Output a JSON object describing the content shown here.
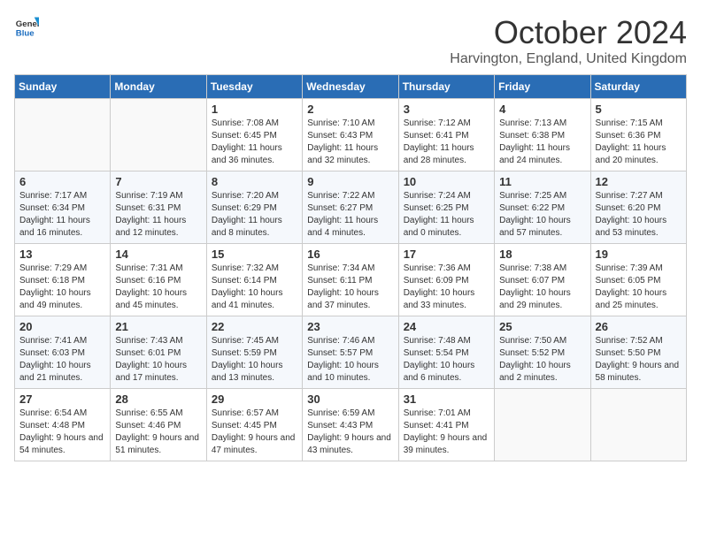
{
  "header": {
    "logo_general": "General",
    "logo_blue": "Blue",
    "month": "October 2024",
    "location": "Harvington, England, United Kingdom"
  },
  "days_of_week": [
    "Sunday",
    "Monday",
    "Tuesday",
    "Wednesday",
    "Thursday",
    "Friday",
    "Saturday"
  ],
  "weeks": [
    [
      {
        "day": "",
        "info": ""
      },
      {
        "day": "",
        "info": ""
      },
      {
        "day": "1",
        "info": "Sunrise: 7:08 AM\nSunset: 6:45 PM\nDaylight: 11 hours and 36 minutes."
      },
      {
        "day": "2",
        "info": "Sunrise: 7:10 AM\nSunset: 6:43 PM\nDaylight: 11 hours and 32 minutes."
      },
      {
        "day": "3",
        "info": "Sunrise: 7:12 AM\nSunset: 6:41 PM\nDaylight: 11 hours and 28 minutes."
      },
      {
        "day": "4",
        "info": "Sunrise: 7:13 AM\nSunset: 6:38 PM\nDaylight: 11 hours and 24 minutes."
      },
      {
        "day": "5",
        "info": "Sunrise: 7:15 AM\nSunset: 6:36 PM\nDaylight: 11 hours and 20 minutes."
      }
    ],
    [
      {
        "day": "6",
        "info": "Sunrise: 7:17 AM\nSunset: 6:34 PM\nDaylight: 11 hours and 16 minutes."
      },
      {
        "day": "7",
        "info": "Sunrise: 7:19 AM\nSunset: 6:31 PM\nDaylight: 11 hours and 12 minutes."
      },
      {
        "day": "8",
        "info": "Sunrise: 7:20 AM\nSunset: 6:29 PM\nDaylight: 11 hours and 8 minutes."
      },
      {
        "day": "9",
        "info": "Sunrise: 7:22 AM\nSunset: 6:27 PM\nDaylight: 11 hours and 4 minutes."
      },
      {
        "day": "10",
        "info": "Sunrise: 7:24 AM\nSunset: 6:25 PM\nDaylight: 11 hours and 0 minutes."
      },
      {
        "day": "11",
        "info": "Sunrise: 7:25 AM\nSunset: 6:22 PM\nDaylight: 10 hours and 57 minutes."
      },
      {
        "day": "12",
        "info": "Sunrise: 7:27 AM\nSunset: 6:20 PM\nDaylight: 10 hours and 53 minutes."
      }
    ],
    [
      {
        "day": "13",
        "info": "Sunrise: 7:29 AM\nSunset: 6:18 PM\nDaylight: 10 hours and 49 minutes."
      },
      {
        "day": "14",
        "info": "Sunrise: 7:31 AM\nSunset: 6:16 PM\nDaylight: 10 hours and 45 minutes."
      },
      {
        "day": "15",
        "info": "Sunrise: 7:32 AM\nSunset: 6:14 PM\nDaylight: 10 hours and 41 minutes."
      },
      {
        "day": "16",
        "info": "Sunrise: 7:34 AM\nSunset: 6:11 PM\nDaylight: 10 hours and 37 minutes."
      },
      {
        "day": "17",
        "info": "Sunrise: 7:36 AM\nSunset: 6:09 PM\nDaylight: 10 hours and 33 minutes."
      },
      {
        "day": "18",
        "info": "Sunrise: 7:38 AM\nSunset: 6:07 PM\nDaylight: 10 hours and 29 minutes."
      },
      {
        "day": "19",
        "info": "Sunrise: 7:39 AM\nSunset: 6:05 PM\nDaylight: 10 hours and 25 minutes."
      }
    ],
    [
      {
        "day": "20",
        "info": "Sunrise: 7:41 AM\nSunset: 6:03 PM\nDaylight: 10 hours and 21 minutes."
      },
      {
        "day": "21",
        "info": "Sunrise: 7:43 AM\nSunset: 6:01 PM\nDaylight: 10 hours and 17 minutes."
      },
      {
        "day": "22",
        "info": "Sunrise: 7:45 AM\nSunset: 5:59 PM\nDaylight: 10 hours and 13 minutes."
      },
      {
        "day": "23",
        "info": "Sunrise: 7:46 AM\nSunset: 5:57 PM\nDaylight: 10 hours and 10 minutes."
      },
      {
        "day": "24",
        "info": "Sunrise: 7:48 AM\nSunset: 5:54 PM\nDaylight: 10 hours and 6 minutes."
      },
      {
        "day": "25",
        "info": "Sunrise: 7:50 AM\nSunset: 5:52 PM\nDaylight: 10 hours and 2 minutes."
      },
      {
        "day": "26",
        "info": "Sunrise: 7:52 AM\nSunset: 5:50 PM\nDaylight: 9 hours and 58 minutes."
      }
    ],
    [
      {
        "day": "27",
        "info": "Sunrise: 6:54 AM\nSunset: 4:48 PM\nDaylight: 9 hours and 54 minutes."
      },
      {
        "day": "28",
        "info": "Sunrise: 6:55 AM\nSunset: 4:46 PM\nDaylight: 9 hours and 51 minutes."
      },
      {
        "day": "29",
        "info": "Sunrise: 6:57 AM\nSunset: 4:45 PM\nDaylight: 9 hours and 47 minutes."
      },
      {
        "day": "30",
        "info": "Sunrise: 6:59 AM\nSunset: 4:43 PM\nDaylight: 9 hours and 43 minutes."
      },
      {
        "day": "31",
        "info": "Sunrise: 7:01 AM\nSunset: 4:41 PM\nDaylight: 9 hours and 39 minutes."
      },
      {
        "day": "",
        "info": ""
      },
      {
        "day": "",
        "info": ""
      }
    ]
  ]
}
